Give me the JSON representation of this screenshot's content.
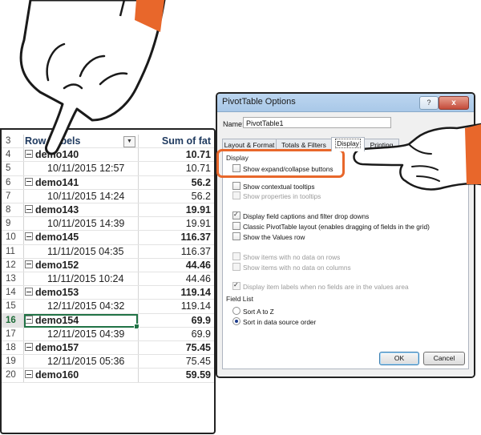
{
  "excel": {
    "header": {
      "row_num": "3",
      "col_a": "Row Labels",
      "col_b": "Sum of fat"
    },
    "rows": [
      {
        "num": "4",
        "label": "demo140",
        "value": "10.71",
        "group": true
      },
      {
        "num": "5",
        "label": "10/11/2015 12:57",
        "value": "10.71",
        "group": false
      },
      {
        "num": "6",
        "label": "demo141",
        "value": "56.2",
        "group": true
      },
      {
        "num": "7",
        "label": "10/11/2015 14:24",
        "value": "56.2",
        "group": false
      },
      {
        "num": "8",
        "label": "demo143",
        "value": "19.91",
        "group": true
      },
      {
        "num": "9",
        "label": "10/11/2015 14:39",
        "value": "19.91",
        "group": false
      },
      {
        "num": "10",
        "label": "demo145",
        "value": "116.37",
        "group": true
      },
      {
        "num": "11",
        "label": "11/11/2015 04:35",
        "value": "116.37",
        "group": false
      },
      {
        "num": "12",
        "label": "demo152",
        "value": "44.46",
        "group": true
      },
      {
        "num": "13",
        "label": "11/11/2015 10:24",
        "value": "44.46",
        "group": false
      },
      {
        "num": "14",
        "label": "demo153",
        "value": "119.14",
        "group": true
      },
      {
        "num": "15",
        "label": "12/11/2015 04:32",
        "value": "119.14",
        "group": false
      },
      {
        "num": "16",
        "label": "demo154",
        "value": "69.9",
        "group": true
      },
      {
        "num": "17",
        "label": "12/11/2015 04:39",
        "value": "69.9",
        "group": false
      },
      {
        "num": "18",
        "label": "demo157",
        "value": "75.45",
        "group": true
      },
      {
        "num": "19",
        "label": "12/11/2015 05:36",
        "value": "75.45",
        "group": false
      },
      {
        "num": "20",
        "label": "demo160",
        "value": "59.59",
        "group": true
      }
    ],
    "selected_row": "16"
  },
  "dialog": {
    "title": "PivotTable Options",
    "help_btn": "?",
    "close_btn": "x",
    "name_label": "Name:",
    "name_value": "PivotTable1",
    "tabs": [
      "Layout & Format",
      "Totals & Filters",
      "Display",
      "Printing"
    ],
    "active_tab": "Display",
    "display_section": "Display",
    "options": [
      {
        "label": "Show expand/collapse buttons",
        "checked": false,
        "disabled": false
      },
      {
        "label": "Show contextual tooltips",
        "checked": false,
        "disabled": false
      },
      {
        "label": "Show properties in tooltips",
        "checked": false,
        "disabled": true
      },
      {
        "label": "Display field captions and filter drop downs",
        "checked": true,
        "disabled": false
      },
      {
        "label": "Classic PivotTable layout (enables dragging of fields in the grid)",
        "checked": false,
        "disabled": false
      },
      {
        "label": "Show the Values row",
        "checked": false,
        "disabled": false
      },
      {
        "label": "Show items with no data on rows",
        "checked": false,
        "disabled": true
      },
      {
        "label": "Show items with no data on columns",
        "checked": false,
        "disabled": true
      },
      {
        "label": "Display item labels when no fields are in the values area",
        "checked": true,
        "disabled": true
      }
    ],
    "field_list_section": "Field List",
    "sort_options": [
      {
        "label": "Sort A to Z",
        "selected": false
      },
      {
        "label": "Sort in data source order",
        "selected": true
      }
    ],
    "ok_label": "OK",
    "cancel_label": "Cancel"
  },
  "colors": {
    "highlight": "#e8672b",
    "selection": "#217346",
    "hand_sleeve": "#e8672b",
    "header_text": "#1f3a5f"
  },
  "icons": {
    "hand_top": "pointing-hand-icon",
    "hand_right": "pointing-hand-icon"
  }
}
